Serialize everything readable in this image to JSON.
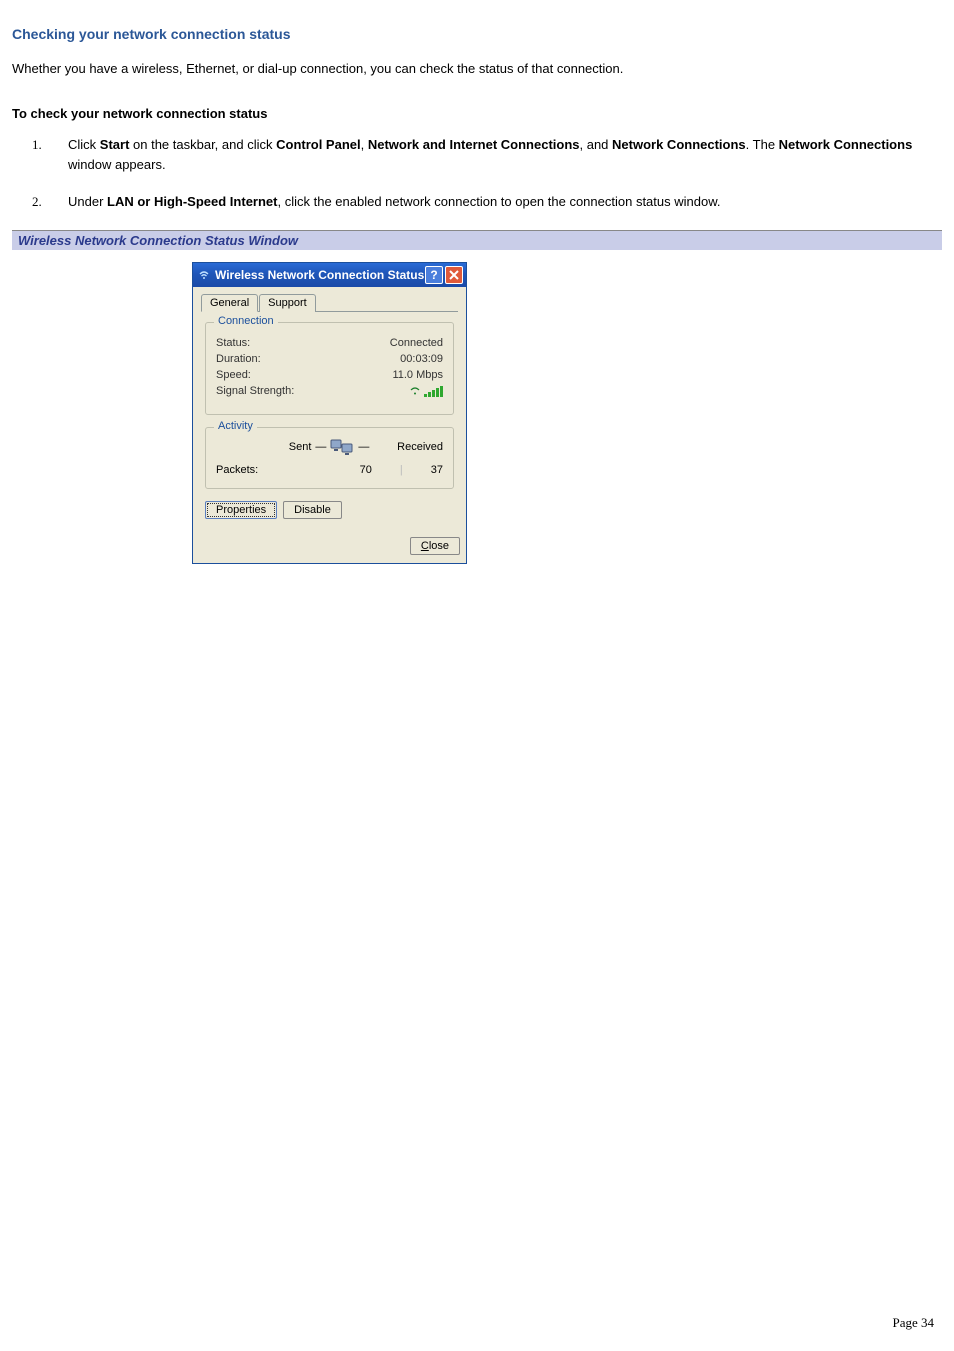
{
  "heading": "Checking your network connection status",
  "intro": "Whether you have a wireless, Ethernet, or dial-up connection, you can check the status of that connection.",
  "sub_heading": "To check your network connection status",
  "steps": {
    "s1": {
      "pre": "Click ",
      "b1": "Start",
      "m1": " on the taskbar, and click ",
      "b2": "Control Panel",
      "m2": ", ",
      "b3": "Network and Internet Connections",
      "m3": ", and ",
      "b4": "Network Connections",
      "m4": ". The ",
      "b5": "Network Connections",
      "m5": " window appears."
    },
    "s2": {
      "pre": "Under ",
      "b1": "LAN or High-Speed Internet",
      "post": ", click the enabled network connection to open the connection status window."
    }
  },
  "caption": "Wireless Network Connection Status Window",
  "dialog": {
    "title": "Wireless Network Connection Status",
    "tabs": {
      "general": "General",
      "support": "Support"
    },
    "connection": {
      "group_label": "Connection",
      "status_label": "Status:",
      "status_value": "Connected",
      "duration_label": "Duration:",
      "duration_value": "00:03:09",
      "speed_label": "Speed:",
      "speed_value": "11.0 Mbps",
      "signal_label": "Signal Strength:"
    },
    "activity": {
      "group_label": "Activity",
      "sent_label": "Sent",
      "received_label": "Received",
      "packets_label": "Packets:",
      "sent_value": "70",
      "received_value": "37"
    },
    "buttons": {
      "properties": "Properties",
      "disable": "Disable",
      "close_letter": "C",
      "close_rest": "lose"
    }
  },
  "page_number": "Page 34"
}
